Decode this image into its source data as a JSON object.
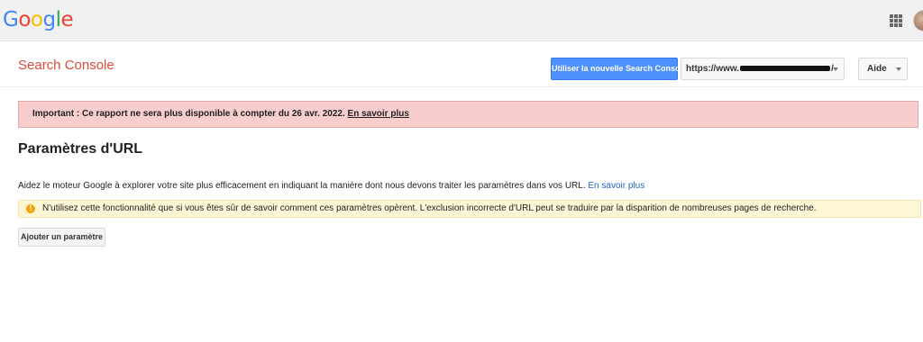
{
  "header": {
    "logo_letters": [
      {
        "char": "G",
        "color": "#4285f4"
      },
      {
        "char": "o",
        "color": "#ea4335"
      },
      {
        "char": "o",
        "color": "#fbbc05"
      },
      {
        "char": "g",
        "color": "#4285f4"
      },
      {
        "char": "l",
        "color": "#34a853"
      },
      {
        "char": "e",
        "color": "#ea4335"
      }
    ],
    "apps_icon": "apps-grid-icon",
    "avatar_icon": "user-avatar"
  },
  "toolbar": {
    "product_name": "Search Console",
    "new_console_button": "Utiliser la nouvelle Search Console",
    "site_selector_prefix": "https://www.",
    "site_selector_suffix": "/",
    "help_button": "Aide"
  },
  "banner": {
    "text": "Important : Ce rapport ne sera plus disponible à compter du 26 avr. 2022.",
    "link": "En savoir plus"
  },
  "main": {
    "title": "Paramètres d'URL",
    "description": "Aidez le moteur Google à explorer votre site plus efficacement en indiquant la manière dont nous devons traiter les paramètres dans vos URL.",
    "description_link": "En savoir plus",
    "warning_text": "N'utilisez cette fonctionnalité que si vous êtes sûr de savoir comment ces paramètres opèrent. L'exclusion incorrecte d'URL peut se traduire par la disparition de nombreuses pages de recherche.",
    "add_parameter_button": "Ajouter un paramètre"
  },
  "colors": {
    "product_red": "#dd4b39",
    "primary_blue": "#4d90fe",
    "banner_pink": "#f7cdcd",
    "warning_yellow": "#fdf6d5",
    "link_blue": "#1a66c8"
  }
}
